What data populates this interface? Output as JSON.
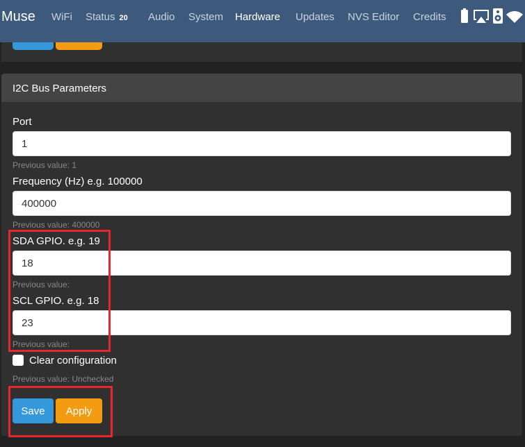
{
  "navbar": {
    "brand": "Muse",
    "items": [
      {
        "label": "WiFi"
      },
      {
        "label": "Status",
        "badge": "20"
      },
      {
        "label": "Audio"
      },
      {
        "label": "System"
      },
      {
        "label": "Hardware"
      },
      {
        "label": "Updates"
      },
      {
        "label": "NVS Editor"
      },
      {
        "label": "Credits"
      }
    ],
    "active": "Hardware",
    "status_icons": [
      "battery-icon",
      "airplay-icon",
      "speaker-icon",
      "wifi-icon"
    ]
  },
  "section": {
    "title": "I2C Bus Parameters",
    "fields": [
      {
        "label": "Port",
        "value": "1",
        "previous": "Previous value: 1"
      },
      {
        "label": "Frequency (Hz) e.g. 100000",
        "value": "400000",
        "previous": "Previous value: 400000"
      },
      {
        "label": "SDA GPIO. e.g. 19",
        "value": "18",
        "previous": "Previous value:"
      },
      {
        "label": "SCL GPIO. e.g. 18",
        "value": "23",
        "previous": "Previous value:"
      }
    ],
    "checkbox": {
      "label": "Clear configuration",
      "checked": false,
      "previous": "Previous value: Unchecked"
    },
    "buttons": {
      "save": "Save",
      "apply": "Apply"
    }
  },
  "colors": {
    "navbar_bg": "#3d5a7d",
    "page_bg": "#222222",
    "card_bg": "#303030",
    "card_header_bg": "#444444",
    "save_button": "#3498db",
    "apply_button": "#f39c12",
    "highlight_border": "#e8262f"
  }
}
